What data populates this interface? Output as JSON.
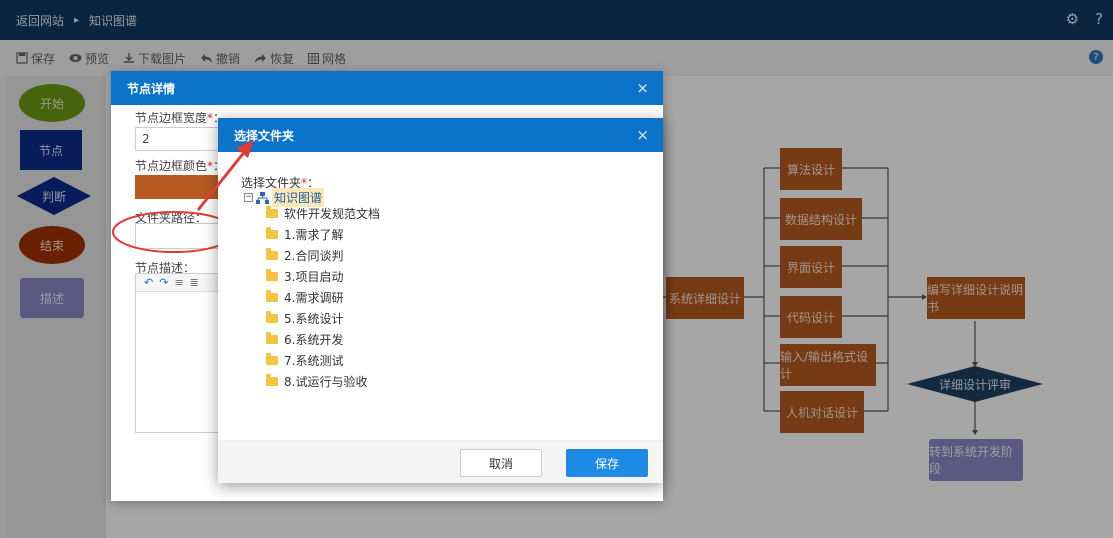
{
  "topbar": {
    "back_label": "返回网站",
    "separator": "▸",
    "current_label": "知识图谱",
    "gear_glyph": "⚙",
    "help_glyph": "?"
  },
  "toolbar": {
    "save": "保存",
    "preview": "预览",
    "download": "下载图片",
    "undo": "撤销",
    "redo": "恢复",
    "grid": "网格"
  },
  "palette": {
    "start": "开始",
    "node": "节点",
    "judge": "判断",
    "end": "结束",
    "desc": "描述"
  },
  "flow": {
    "system_detail": "系统详细设计",
    "algorithm": "算法设计",
    "data_structure": "数据结构设计",
    "ui_design": "界面设计",
    "code_design": "代码设计",
    "io_format": "输入/输出格式设计",
    "hci_design": "人机对话设计",
    "write_doc": "编写详细设计说明书",
    "review": "详细设计评审",
    "next_phase": "转到系统开发阶段"
  },
  "node_dialog": {
    "title": "节点详情",
    "close": "×",
    "border_width_label": "节点边框宽度",
    "border_width_value": "2",
    "border_color_label": "节点边框颜色",
    "folder_path_label": "文件夹路径：",
    "desc_label": "节点描述：",
    "required_mark": "*",
    "colon": "："
  },
  "folder_dialog": {
    "title": "选择文件夹",
    "close": "×",
    "field_label": "选择文件夹",
    "required_mark": "*",
    "colon": "：",
    "root": "知识图谱",
    "folders": [
      "软件开发规范文档",
      "1.需求了解",
      "2.合同谈判",
      "3.项目启动",
      "4.需求调研",
      "5.系统设计",
      "6.系统开发",
      "7.系统测试",
      "8.试运行与验收"
    ],
    "cancel": "取消",
    "save": "保存"
  },
  "colors": {
    "header_blue": "#0b73c8",
    "topbar": "#0f3a63",
    "flow_orange": "#b65a21",
    "review_diamond": "#1e3f63",
    "annotation_red": "#e53935"
  }
}
